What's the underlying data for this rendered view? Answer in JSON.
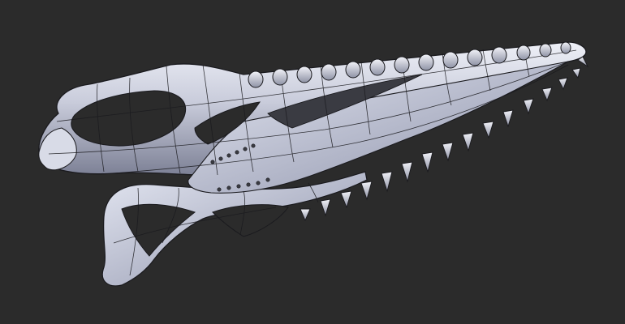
{
  "viewport": {
    "background": "#2b2b2b",
    "subject": "skull-mesh",
    "shading": "solid-matcap",
    "wireframe_overlay": true,
    "colors": {
      "bone_light": "#e9ebf4",
      "bone_mid": "#b7bbcc",
      "bone_dark": "#6e7286",
      "wire": "#1a1a1e"
    }
  }
}
